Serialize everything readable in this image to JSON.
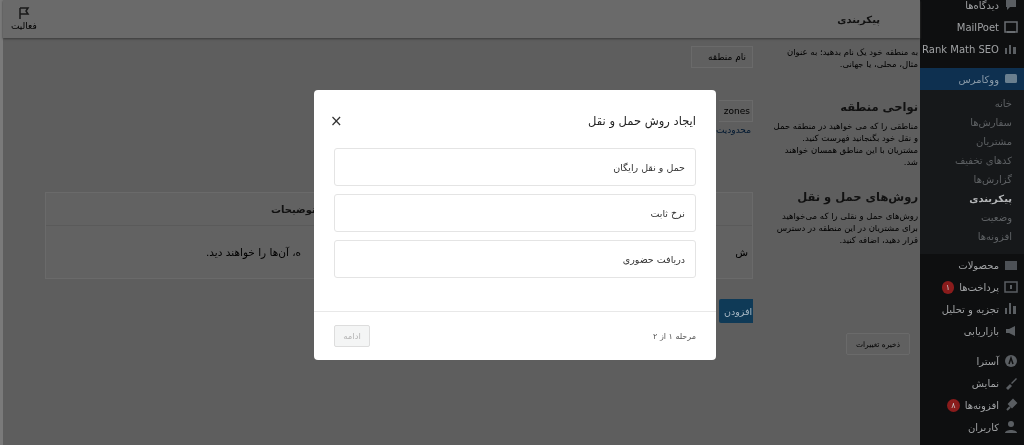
{
  "header": {
    "title": "پیکربندی",
    "activity": {
      "label": "فعالیت"
    }
  },
  "sections": [
    {
      "description": "به منطقه خود یک نام بدهید؛ به عنوان مثال، محلی، یا جهانی.",
      "field": {
        "placeholder": "نام منطقه"
      }
    },
    {
      "heading": "نواحی منطقه",
      "description": "مناطقی را که می خواهید در منطقه حمل و نقل خود بگنجانید فهرست کنید. مشتریان با این مناطق همسان خواهند شد.",
      "field": {
        "placeholder": "zones"
      },
      "link": "محدودیت"
    },
    {
      "heading": "روش‌های حمل و نقل",
      "description": "روش‌های حمل و نقلی را که می‌خواهید برای مشتریان در این منطقه در دسترس قرار دهید، اضافه کنید.",
      "table": {
        "header": "توضیحات",
        "row_left": "ه، آن‌ها را خواهند دید.",
        "row_right": "ش"
      },
      "add_button": "افزودن"
    }
  ],
  "save_button": {
    "label": "ذخیره تغییرات",
    "disabled": true
  },
  "sidebar": [
    {
      "kind": "menu",
      "label": "دیدگاه‌ها",
      "selected": false
    },
    {
      "kind": "menu",
      "label": "MailPoet",
      "selected": false
    },
    {
      "kind": "menu",
      "label": "Rank Math SEO",
      "selected": false
    },
    {
      "kind": "separator"
    },
    {
      "kind": "menu",
      "label": "ووکامرس",
      "selected": true,
      "children": [
        {
          "label": "خانه",
          "selected": false
        },
        {
          "label": "سفارش‌ها",
          "selected": false
        },
        {
          "label": "مشتریان",
          "selected": false
        },
        {
          "label": "کدهای تخفیف",
          "selected": false
        },
        {
          "label": "گزارش‌ها",
          "selected": false
        },
        {
          "label": "پیکربندی",
          "selected": true
        },
        {
          "label": "وضعیت",
          "selected": false
        },
        {
          "label": "افزونه‌ها",
          "selected": false
        }
      ]
    },
    {
      "kind": "menu",
      "label": "محصولات",
      "selected": false
    },
    {
      "kind": "menu",
      "label": "پرداخت‌ها",
      "selected": false,
      "badge": "۱"
    },
    {
      "kind": "menu",
      "label": "تجزیه و تحلیل",
      "selected": false
    },
    {
      "kind": "menu",
      "label": "بازاریابی",
      "selected": false
    },
    {
      "kind": "separator"
    },
    {
      "kind": "menu",
      "label": "آسترا",
      "selected": false
    },
    {
      "kind": "menu",
      "label": "نمایش",
      "selected": false
    },
    {
      "kind": "menu",
      "label": "افزونه‌ها",
      "selected": false,
      "badge": "۸"
    },
    {
      "kind": "menu",
      "label": "کاربران",
      "selected": false
    }
  ],
  "modal": {
    "title": "ایجاد روش حمل و نقل",
    "close": "×",
    "options": [
      {
        "label": "حمل و نقل رایگان",
        "selected": false
      },
      {
        "label": "نرخ ثابت",
        "selected": false
      },
      {
        "label": "دریافت حضوری",
        "selected": false
      }
    ],
    "step": "مرحله ۱ از ۲",
    "continue": {
      "label": "ادامه",
      "disabled": true
    }
  }
}
